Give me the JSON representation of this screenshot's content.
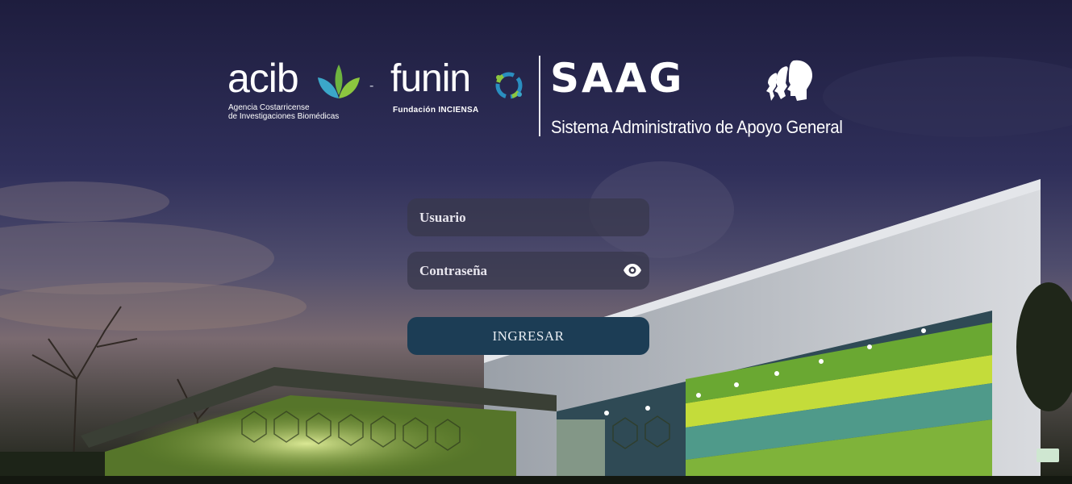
{
  "brand": {
    "acib_name": "acib",
    "acib_subtitle_line1": "Agencia Costarricense",
    "acib_subtitle_line2": "de Investigaciones Biomédicas",
    "separator": "-",
    "funin_name": "funin",
    "funin_subtitle": "Fundación INCIENSA",
    "saag_name": "SAAG",
    "saag_subtitle": "Sistema Administrativo de Apoyo General"
  },
  "login": {
    "username_placeholder": "Usuario",
    "password_placeholder": "Contraseña",
    "submit_label": "INGRESAR"
  },
  "colors": {
    "button_bg": "#1c3d55",
    "field_bg": "rgba(55,55,75,0.72)"
  },
  "icons": {
    "password_toggle": "eye-icon",
    "saag_logo": "heads-profile-icon",
    "acib_logo": "leaf-icon",
    "funin_logo": "ring-icon"
  }
}
